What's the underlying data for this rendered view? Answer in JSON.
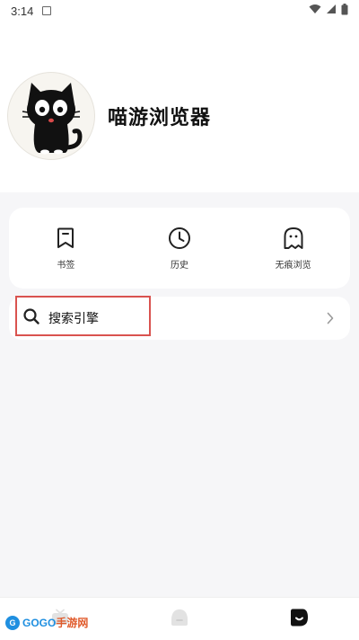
{
  "status_bar": {
    "time": "3:14"
  },
  "profile": {
    "app_name": "喵游浏览器"
  },
  "quick_actions": [
    {
      "label": "书签",
      "icon": "bookmark-icon"
    },
    {
      "label": "历史",
      "icon": "clock-icon"
    },
    {
      "label": "无痕浏览",
      "icon": "ghost-icon"
    }
  ],
  "search_engine": {
    "label": "搜索引擎"
  },
  "watermark": {
    "brand": "GOGO",
    "suffix": "手游网"
  },
  "colors": {
    "background": "#f6f6f8",
    "card": "#ffffff",
    "highlight": "#d9534f",
    "watermark_blue": "#1f8fe0"
  }
}
